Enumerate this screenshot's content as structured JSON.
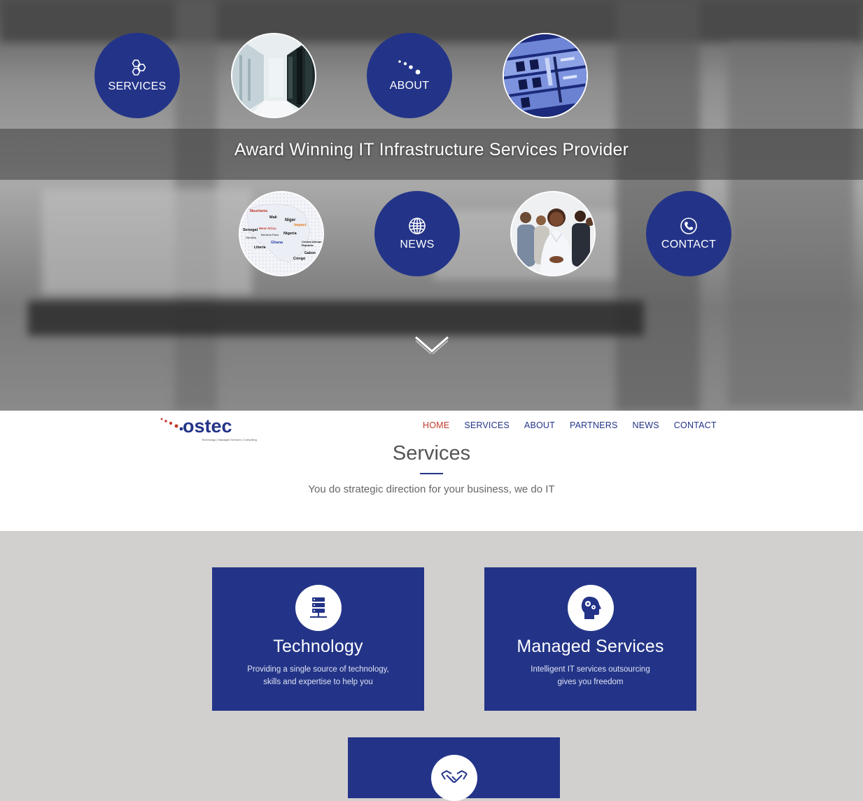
{
  "hero": {
    "tagline": "Award Winning IT Infrastructure Services Provider",
    "tiles": {
      "services": "SERVICES",
      "about": "ABOUT",
      "news": "NEWS",
      "contact": "CONTACT"
    },
    "africa_map_words": [
      "Mali",
      "Niger",
      "Senegal",
      "Nigeria",
      "Ghana",
      "Congo",
      "Liberia",
      "Impact",
      "West Africa",
      "Gabon",
      "Central African Republic",
      "Mauritania"
    ]
  },
  "brand": {
    "name": "ostec",
    "tagline": "Technology | Managed Services | Consulting"
  },
  "nav": {
    "items": [
      {
        "label": "HOME",
        "active": true
      },
      {
        "label": "SERVICES",
        "active": false
      },
      {
        "label": "ABOUT",
        "active": false
      },
      {
        "label": "PARTNERS",
        "active": false
      },
      {
        "label": "NEWS",
        "active": false
      },
      {
        "label": "CONTACT",
        "active": false
      }
    ]
  },
  "services": {
    "title": "Services",
    "subtitle": "You do strategic direction for your business, we do IT",
    "cards": [
      {
        "title": "Technology",
        "line1": "Providing a single source of technology,",
        "line2": "skills and expertise to help you",
        "icon": "server-icon"
      },
      {
        "title": "Managed Services",
        "line1": "Intelligent IT services outsourcing",
        "line2": "gives you freedom",
        "icon": "head-gears-icon"
      },
      {
        "title": "",
        "line1": "",
        "line2": "",
        "icon": "handshake-icon"
      }
    ]
  },
  "colors": {
    "brand_blue": "#233488",
    "accent_red": "#c0392b",
    "grey_bg": "#d1d0cf"
  }
}
